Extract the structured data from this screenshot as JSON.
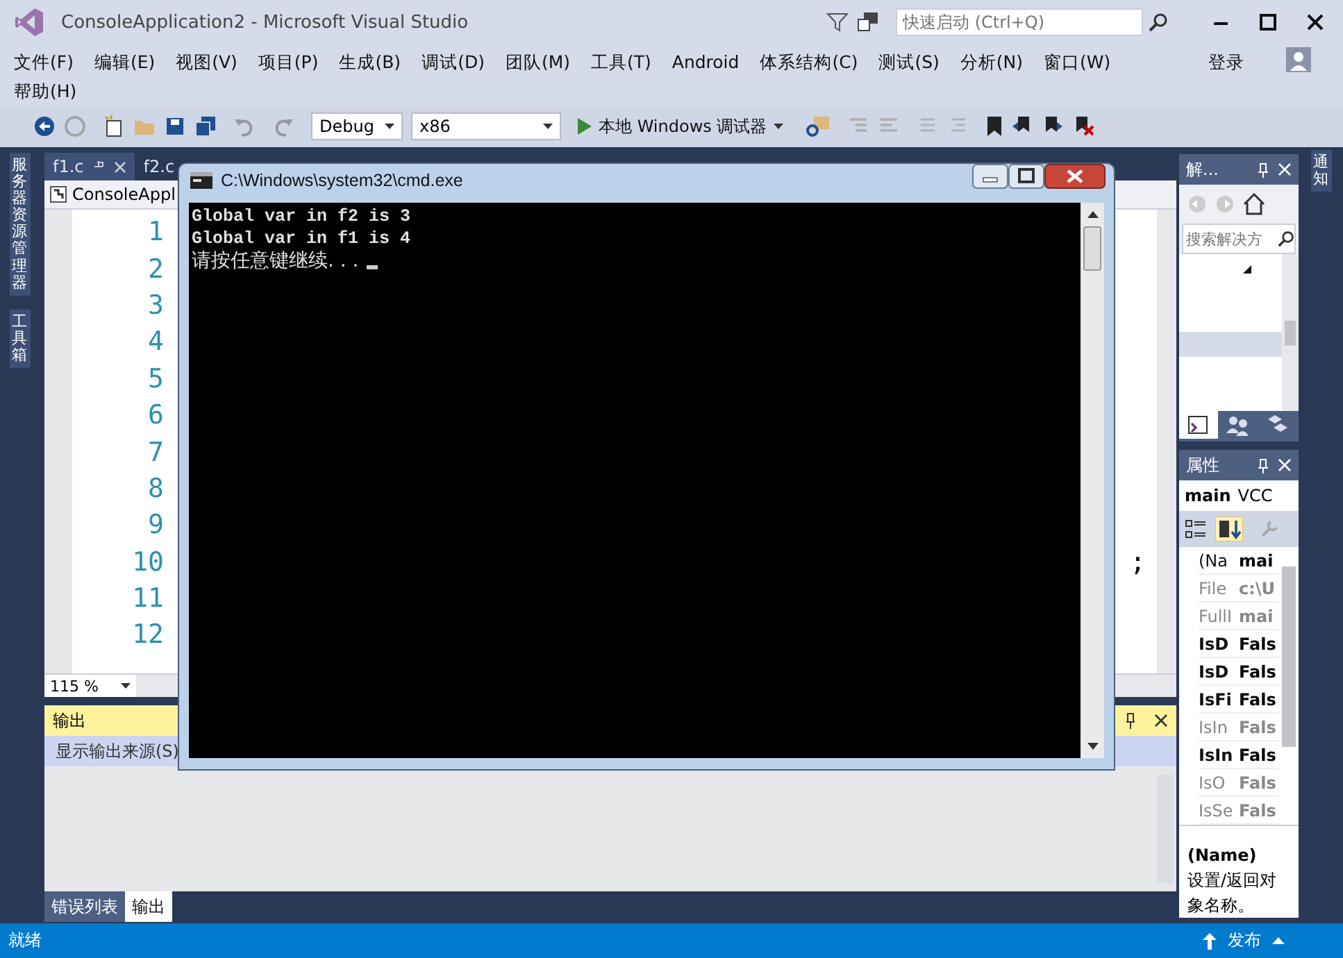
{
  "window": {
    "title": "ConsoleApplication2 - Microsoft Visual Studio",
    "quick_launch": {
      "placeholder": "快速启动 (Ctrl+Q)"
    }
  },
  "menu": {
    "items": [
      "文件(F)",
      "编辑(E)",
      "视图(V)",
      "项目(P)",
      "生成(B)",
      "调试(D)",
      "团队(M)",
      "工具(T)",
      "Android",
      "体系结构(C)",
      "测试(S)",
      "分析(N)",
      "窗口(W)",
      "帮助(H)"
    ],
    "sign_in": "登录"
  },
  "toolbar": {
    "configuration": "Debug",
    "platform": "x86",
    "start_button": "本地 Windows 调试器"
  },
  "left_tabs": [
    "服务器资源管理器",
    "工具箱"
  ],
  "editor": {
    "tabs": [
      {
        "label": "f1.c",
        "selected": true
      },
      {
        "label": "f2.c",
        "selected": false
      }
    ],
    "navigation": "ConsoleAppl",
    "zoom": "115 %",
    "lines": [
      {
        "number": "1"
      },
      {
        "number": "2"
      },
      {
        "number": "3"
      },
      {
        "number": "4"
      },
      {
        "number": "5"
      },
      {
        "number": "6"
      },
      {
        "number": "7"
      },
      {
        "number": "8"
      },
      {
        "number": "9"
      },
      {
        "number": "10",
        "tail": ";"
      },
      {
        "number": "11"
      },
      {
        "number": "12"
      }
    ]
  },
  "output": {
    "title": "输出",
    "source_label": "显示输出来源(S)",
    "tabs": [
      {
        "label": "错误列表",
        "selected": false
      },
      {
        "label": "输出",
        "selected": true
      }
    ]
  },
  "console": {
    "title": "C:\\Windows\\system32\\cmd.exe",
    "lines": [
      {
        "text": "Global var in f2 is 3",
        "kind": "mono"
      },
      {
        "text": "Global var in f1 is 4",
        "kind": "mono"
      },
      {
        "text": "请按任意键继续. . .",
        "kind": "prompt"
      }
    ]
  },
  "solution_explorer": {
    "title": "解...",
    "search": {
      "placeholder": "搜索解决方"
    }
  },
  "properties": {
    "title": "属性",
    "object": "main",
    "object_type": "VCC",
    "description_title": "(Name)",
    "description": "设置/返回对象名称。",
    "rows": [
      {
        "name": "(Na",
        "value": "mai",
        "readonly": false
      },
      {
        "name": "File",
        "value": "c:\\U",
        "readonly": true
      },
      {
        "name": "FullI",
        "value": "mai",
        "readonly": true
      },
      {
        "name": "IsD",
        "value": "Fals",
        "readonly": false
      },
      {
        "name": "IsD",
        "value": "Fals",
        "readonly": false
      },
      {
        "name": "IsFi",
        "value": "Fals",
        "readonly": false
      },
      {
        "name": "IsIn",
        "value": "Fals",
        "readonly": true
      },
      {
        "name": "IsIn",
        "value": "Fals",
        "readonly": false
      },
      {
        "name": "IsO",
        "value": "Fals",
        "readonly": true
      },
      {
        "name": "IsSe",
        "value": "Fals",
        "readonly": true
      }
    ]
  },
  "right_tabs": [
    "通知"
  ],
  "status_bar": {
    "text": "就绪",
    "publish": "发布"
  }
}
